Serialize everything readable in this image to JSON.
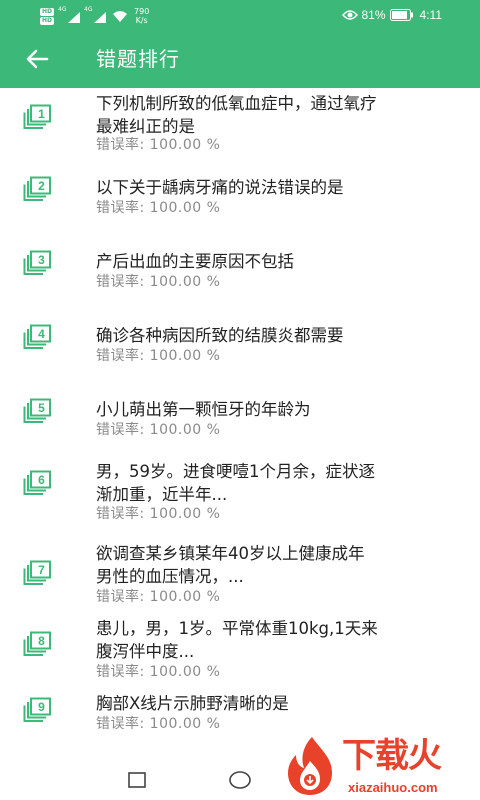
{
  "status_bar": {
    "hd_badge": "HD",
    "sim1_network": "4G",
    "sim2_network": "4G",
    "net_speed_value": "790",
    "net_speed_unit": "K/s",
    "battery_percent": "81%",
    "time": "4:11",
    "icons": [
      "signal-icon",
      "wifi-icon",
      "eye-icon",
      "battery-icon"
    ]
  },
  "app_bar": {
    "title": "错题排行",
    "back_icon": "arrow-left-icon"
  },
  "colors": {
    "primary": "#3cb878",
    "text": "#222222",
    "subtext": "#8a8a8a",
    "watermark": "#e8422b"
  },
  "list": {
    "items": [
      {
        "rank": "1",
        "question": "下列机制所致的低氧血症中，通过氧疗\n最难纠正的是",
        "error_rate": "错误率:  100.00 %"
      },
      {
        "rank": "2",
        "question": "以下关于龋病牙痛的说法错误的是",
        "error_rate": "错误率:  100.00 %"
      },
      {
        "rank": "3",
        "question": "产后出血的主要原因不包括",
        "error_rate": "错误率:  100.00 %"
      },
      {
        "rank": "4",
        "question": "确诊各种病因所致的结膜炎都需要",
        "error_rate": "错误率:  100.00 %"
      },
      {
        "rank": "5",
        "question": "小儿萌出第一颗恒牙的年龄为",
        "error_rate": "错误率:  100.00 %"
      },
      {
        "rank": "6",
        "question": "男，59岁。进食哽噎1个月余，症状逐\n渐加重，近半年...",
        "error_rate": "错误率:  100.00 %"
      },
      {
        "rank": "7",
        "question": "欲调查某乡镇某年40岁以上健康成年\n男性的血压情况，...",
        "error_rate": "错误率:  100.00 %"
      },
      {
        "rank": "8",
        "question": "患儿，男，1岁。平常体重10kg,1天来\n腹泻伴中度...",
        "error_rate": "错误率:  100.00 %"
      },
      {
        "rank": "9",
        "question": "胸部X线片示肺野清晰的是",
        "error_rate": "错误率:  100.00 %"
      }
    ]
  },
  "nav_bar": {
    "icons": [
      "recent-apps-icon",
      "home-icon"
    ]
  },
  "watermark": {
    "title": "下载火",
    "url": "xiazaihuo.com"
  }
}
